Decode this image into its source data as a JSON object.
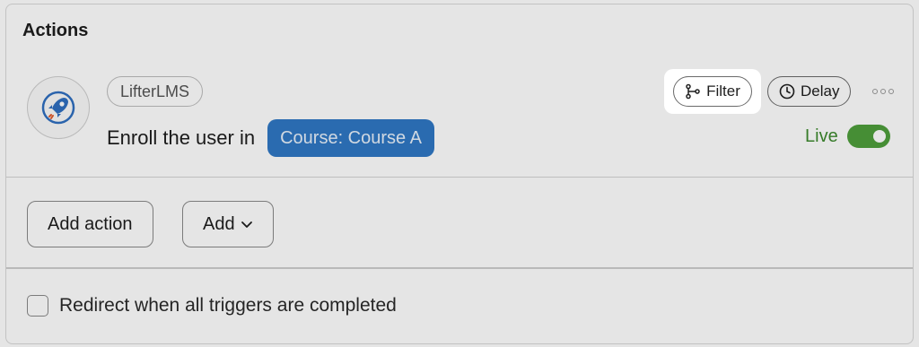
{
  "section": {
    "title": "Actions"
  },
  "action": {
    "integration": "LifterLMS",
    "sentence_prefix": "Enroll the user in",
    "token": "Course: Course A",
    "filter_label": "Filter",
    "delay_label": "Delay",
    "status_label": "Live",
    "status_on": true
  },
  "buttons": {
    "add_action": "Add action",
    "add": "Add"
  },
  "options": {
    "redirect_label": "Redirect when all triggers are completed",
    "redirect_checked": false
  },
  "colors": {
    "token_bg": "#2f78c5",
    "live_green": "#4f9f3c",
    "live_text": "#3d8a2e",
    "rocket_blue": "#2f6fc0"
  },
  "icons": {
    "integration": "rocket-icon",
    "filter": "filter-branch-icon",
    "delay": "clock-icon",
    "more": "more-dots-icon",
    "add_dropdown": "chevron-down-icon"
  }
}
